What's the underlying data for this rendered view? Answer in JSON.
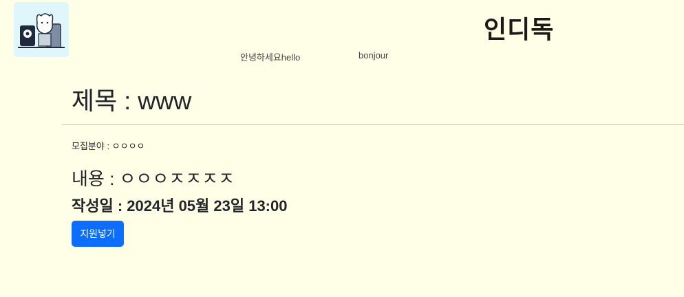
{
  "header": {
    "logo_alt": "인디독 logo",
    "brand": "인디독",
    "nav": [
      {
        "label": "안녕하세요hello"
      },
      {
        "label": "bonjour"
      }
    ]
  },
  "post": {
    "title": "제목 : www",
    "field": "모집분야 : ㅇㅇㅇㅇ",
    "content": "내용 : ㅇㅇㅇㅈㅈㅈㅈ",
    "date": "작성일 : 2024년 05월 23일 13:00",
    "apply_label": "지원넣기"
  },
  "colors": {
    "background": "#fffee6",
    "accent": "#0d6efd"
  }
}
